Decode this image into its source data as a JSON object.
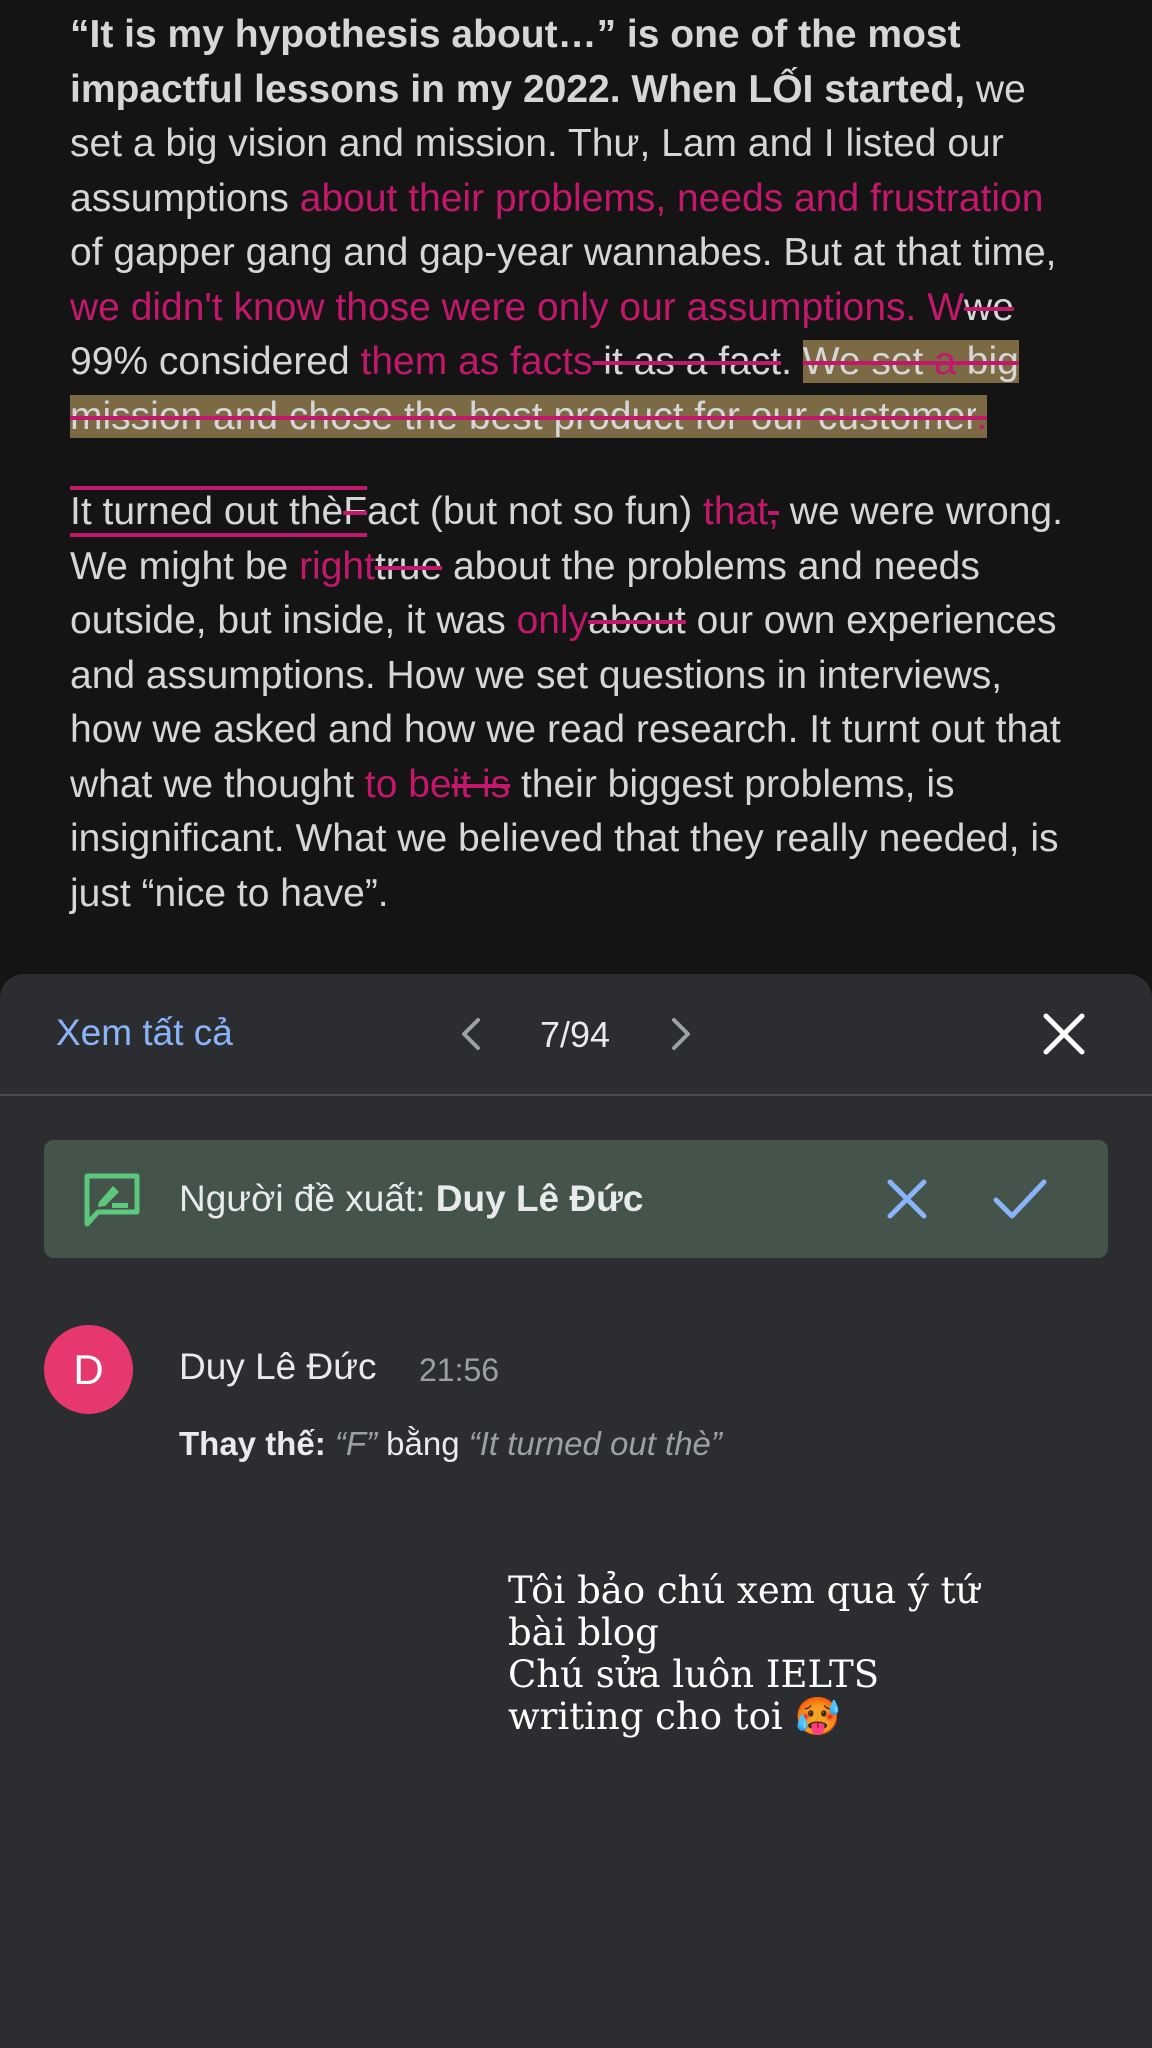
{
  "document": {
    "p1": {
      "s1": "“It is my hypothesis about…” is one of the most impactful lessons in my 2022. When LỐI started,",
      "s2": " we set a big vision and mission. Thư, Lam and I listed our assumptions ",
      "s3": "about their problems, needs and frustration",
      "s4": " of gapper gang and gap-year wannabes. But at that time, ",
      "s5": "we didn't know those were only our assumptions. W",
      "s6": "we",
      "s7": " 99% considered ",
      "s8": "them as facts",
      "s9": " it as a fact",
      "s10": ". ",
      "s11": "We set ",
      "s12": "a",
      "s13": " big mission and chose the best product for our customer",
      "s14": "."
    },
    "p2": {
      "s1": "It turned out thè",
      "s2": "F",
      "s3": "act (but not so fun) ",
      "s4": "that",
      "s5": ",",
      "s6": " we were wrong. We might be ",
      "s7": "right",
      "s8": "true",
      "s9": " about the problems and needs outside, but inside, it was ",
      "s10": "only",
      "s11": "about",
      "s12": " our own experiences and assumptions. How we set questions in interviews, how we asked and how we read research. It turnt out that what we thought ",
      "s13": "to be",
      "s14": "it is",
      "s15": " their biggest problems, is insignificant. What we believed that they really needed, is just “nice to have”."
    }
  },
  "panel": {
    "see_all": "Xem tất cả",
    "counter": "7/94",
    "banner": {
      "label": "Người đề xuất: ",
      "author": "Duy Lê Đức"
    },
    "comment": {
      "avatar_letter": "D",
      "author": "Duy Lê Đức",
      "time": "21:56",
      "action_label": "Thay thế:",
      "from": "“F”",
      "connector": " bằng ",
      "to": "“It turned out thè”"
    }
  },
  "caption": {
    "line1": "Tôi bảo chú xem qua ý tứ",
    "line2": "bài blog",
    "line3": "Chú sửa luôn IELTS",
    "line4": "writing cho toi 🥵"
  },
  "icons": {
    "prev": "chevron-left-icon",
    "next": "chevron-right-icon",
    "close": "close-icon",
    "suggestion": "suggest-edit-icon",
    "reject": "reject-x-icon",
    "accept": "accept-check-icon"
  },
  "colors": {
    "insert": "#c2186b",
    "link": "#8ab4f8",
    "banner": "#44544a",
    "avatar": "#e6386f",
    "highlight": "#7b6a43"
  }
}
